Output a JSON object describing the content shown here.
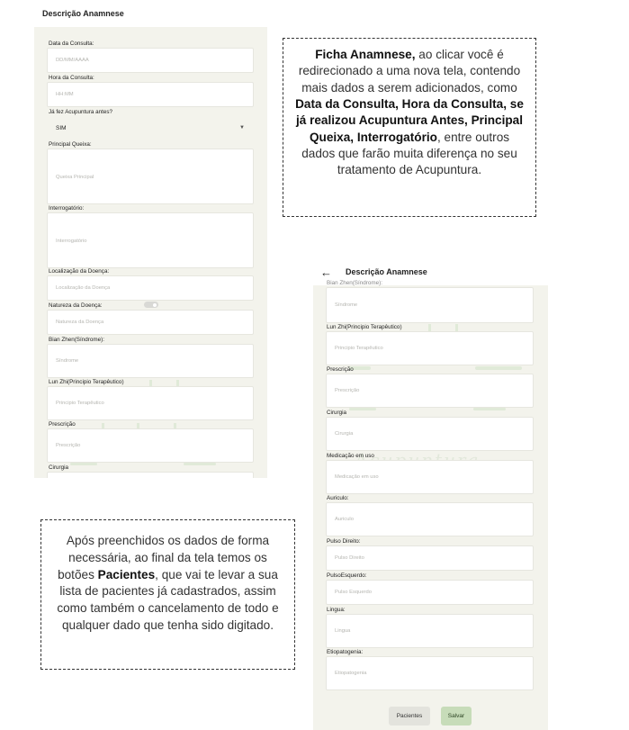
{
  "left_screen": {
    "title": "Descrição Anamnese",
    "back_icon": "arrow-left-icon",
    "fields": {
      "data_consulta": {
        "label": "Data da Consulta:",
        "placeholder": "DD/MM/AAAA"
      },
      "hora_consulta": {
        "label": "Hora da Consulta:",
        "placeholder": "HH:MM"
      },
      "acupuntura": {
        "label": "Já fez Acupuntura antes?",
        "value": "SIM"
      },
      "queixa": {
        "label": "Principal Queixa:",
        "placeholder": "Queixa Principal"
      },
      "interrogatorio": {
        "label": "Interrogatório:",
        "placeholder": "Interrogatório"
      },
      "localizacao": {
        "label": "Localização da Doença:",
        "placeholder": "Localização da Doença"
      },
      "natureza": {
        "label": "Natureza da Doença:",
        "placeholder": "Natureza da Doença"
      },
      "bian_zhen": {
        "label": "Bian Zhen(Síndrome):",
        "placeholder": "Síndrome"
      },
      "lun_zhi": {
        "label": "Lun Zhi(Principio Terapêutico)",
        "placeholder": "Principio Terapêutico"
      },
      "prescricao": {
        "label": "Prescrição",
        "placeholder": "Prescrição"
      },
      "cirurgia": {
        "label": "Cirurgia"
      }
    }
  },
  "right_screen": {
    "title": "Descrição Anamnese",
    "back_icon": "arrow-left-icon",
    "cut_label": "Bian Zhen(Síndrome):",
    "watermark": "Acupuntura",
    "fields": {
      "bian_zhen": {
        "placeholder": "Síndrome"
      },
      "lun_zhi": {
        "label": "Lun Zhi(Principio Terapêutico)",
        "placeholder": "Principio Terapêutico"
      },
      "prescricao": {
        "label": "Prescrição",
        "placeholder": "Prescrição"
      },
      "cirurgia": {
        "label": "Cirurgia",
        "placeholder": "Cirurgia"
      },
      "medicacao": {
        "label": "Medicação em uso",
        "placeholder": "Medicação em uso"
      },
      "auriculo": {
        "label": "Auriculo:",
        "placeholder": "Auriculo"
      },
      "pulso_direito": {
        "label": "Pulso Direito:",
        "placeholder": "Pulso Direito"
      },
      "pulso_esquerdo": {
        "label": "PulsoEsquerdo:",
        "placeholder": "Pulso Esquerdo"
      },
      "lingua": {
        "label": "Lingua:",
        "placeholder": "Lingua"
      },
      "etiopatogenia": {
        "label": "Etiopatogenia:",
        "placeholder": "Etiopatogenia"
      }
    },
    "buttons": {
      "pacientes": "Pacientes",
      "salvar": "Salvar"
    }
  },
  "callout_top": {
    "b1": "Ficha Anamnese,",
    "t1": " ao clicar você é redirecionado a uma nova tela, contendo mais dados a serem adicionados, como ",
    "b2": "Data da Consulta, Hora da Consulta, se já realizou Acupuntura Antes, Principal Queixa, Interrogatório",
    "t2": ", entre outros dados que farão muita diferença no seu tratamento de Acupuntura."
  },
  "callout_bottom": {
    "t1": "Após preenchidos os dados de forma necessária, ao final da tela temos os botões ",
    "b1": "Pacientes",
    "t2": ", que vai te levar a sua lista de pacientes já cadastrados, assim como também o cancelamento de todo e qualquer dado que tenha sido digitado."
  }
}
